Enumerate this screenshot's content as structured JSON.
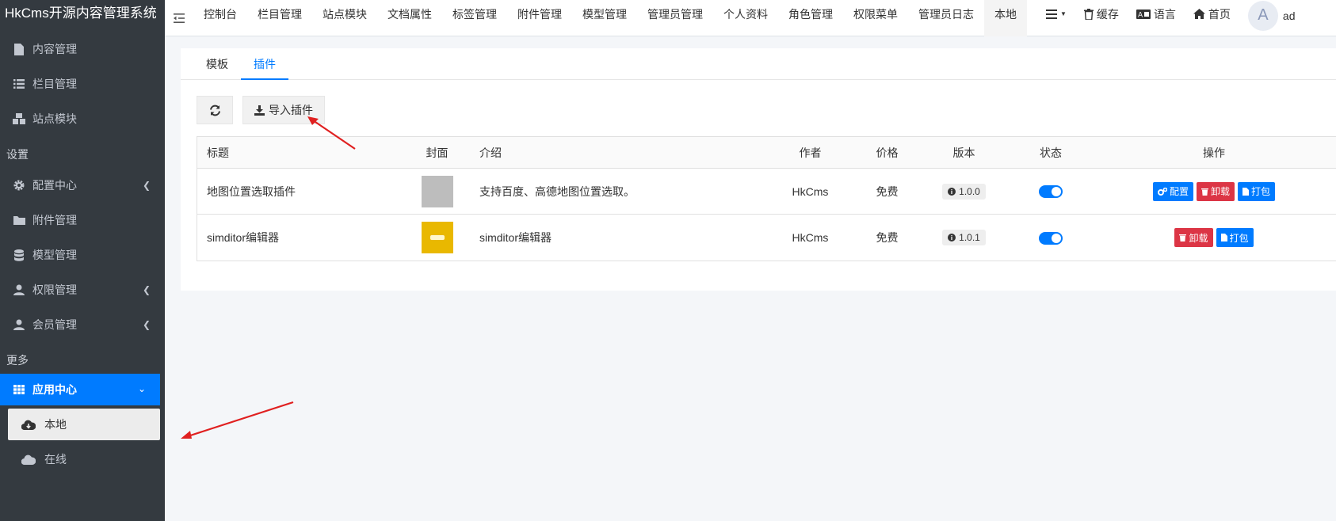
{
  "brand": "HkCms开源内容管理系统",
  "sidebar": {
    "items_top": [
      {
        "label": "内容管理",
        "icon": "file-icon"
      },
      {
        "label": "栏目管理",
        "icon": "list-icon"
      },
      {
        "label": "站点模块",
        "icon": "cubes-icon"
      }
    ],
    "header_settings": "设置",
    "items_settings": [
      {
        "label": "配置中心",
        "icon": "gear-icon"
      },
      {
        "label": "附件管理",
        "icon": "folder-icon"
      },
      {
        "label": "模型管理",
        "icon": "database-icon"
      },
      {
        "label": "权限管理",
        "icon": "user-icon"
      },
      {
        "label": "会员管理",
        "icon": "user-icon"
      }
    ],
    "header_more": "更多",
    "app_center": "应用中心",
    "sub_local": "本地",
    "sub_online": "在线"
  },
  "topbar": {
    "tabs": [
      "控制台",
      "栏目管理",
      "站点模块",
      "文档属性",
      "标签管理",
      "附件管理",
      "模型管理",
      "管理员管理",
      "个人资料",
      "角色管理",
      "权限菜单",
      "管理员日志",
      "本地"
    ],
    "active_tab": "本地",
    "cache": "缓存",
    "language": "语言",
    "home": "首页",
    "avatar_letter": "A",
    "user": "ad"
  },
  "subtabs": [
    "模板",
    "插件"
  ],
  "toolbar": {
    "import": "导入插件"
  },
  "table": {
    "headers": [
      "标题",
      "封面",
      "介绍",
      "作者",
      "价格",
      "版本",
      "状态",
      "操作"
    ],
    "rows": [
      {
        "title": "地图位置选取插件",
        "intro": "支持百度、高德地图位置选取。",
        "author": "HkCms",
        "price": "免费",
        "version": "1.0.0",
        "actions": [
          "配置",
          "卸载",
          "打包"
        ]
      },
      {
        "title": "simditor编辑器",
        "intro": "simditor编辑器",
        "author": "HkCms",
        "price": "免费",
        "version": "1.0.1",
        "actions": [
          "卸载",
          "打包"
        ]
      }
    ]
  },
  "colors": {
    "primary": "#007bff",
    "danger": "#dc3545",
    "sidebar": "#343a40",
    "annotation": "#e02020"
  }
}
